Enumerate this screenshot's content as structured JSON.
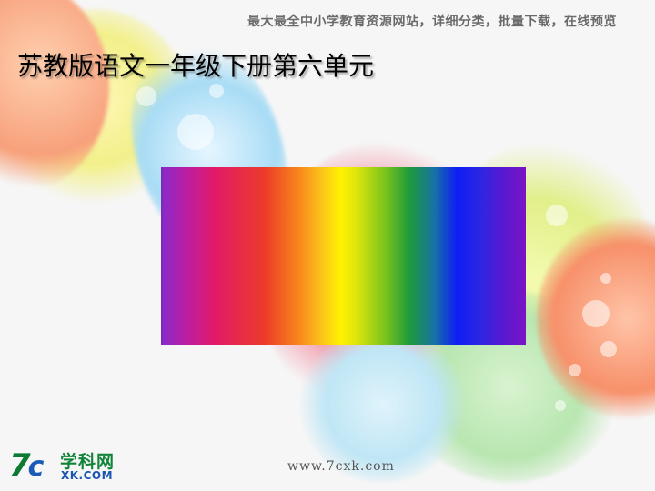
{
  "header": {
    "note": "最大最全中小学教育资源网站，详细分类，批量下载，在线预览",
    "title": "苏教版语文一年级下册第六单元"
  },
  "logo": {
    "mark": "7",
    "mark_c": "c",
    "name_cn": "学科网",
    "name_en": "XK.COM"
  },
  "footer": {
    "url": "www.7cxk.com"
  }
}
